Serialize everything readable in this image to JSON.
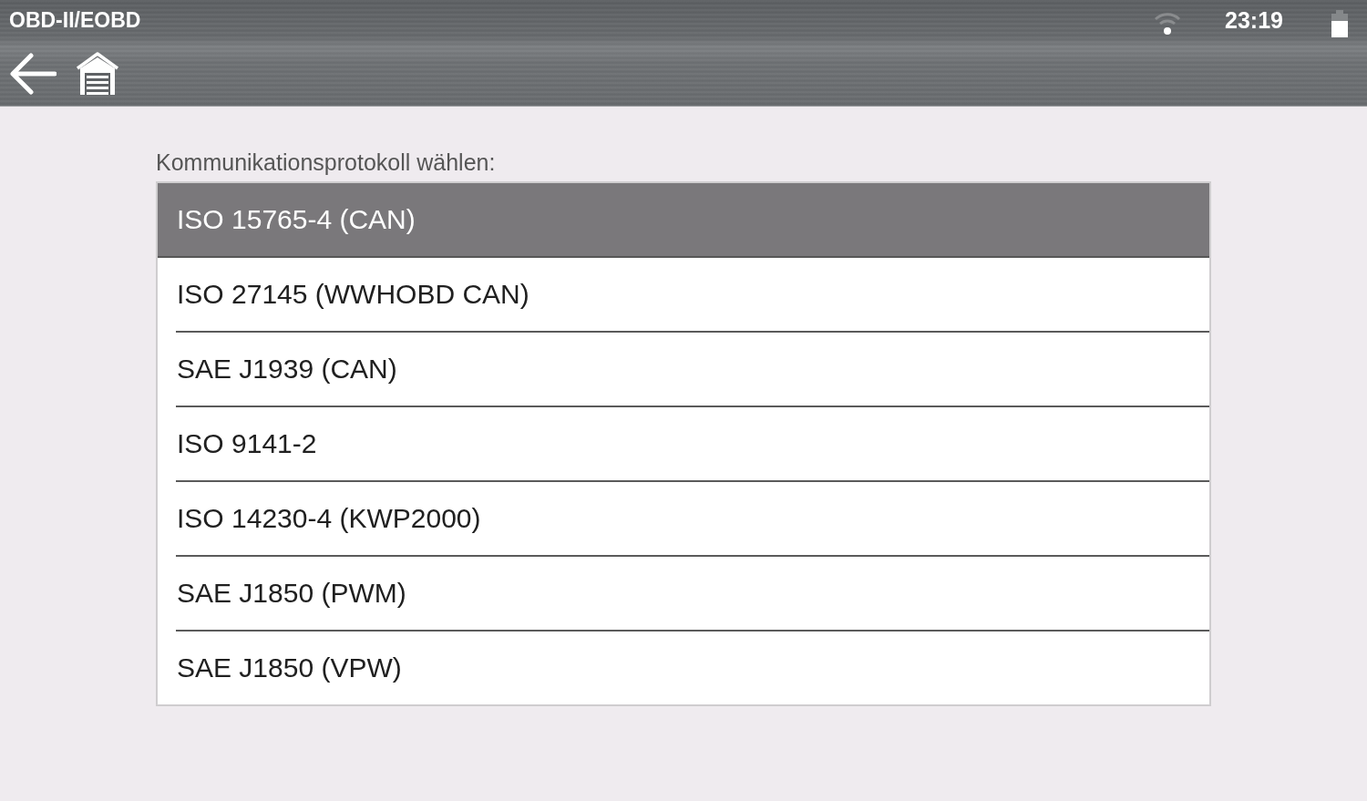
{
  "status_bar": {
    "title": "OBD-II/EOBD",
    "time": "23:19"
  },
  "prompt": "Kommunikationsprotokoll wählen:",
  "protocols": [
    {
      "label": "ISO 15765-4 (CAN)",
      "selected": true
    },
    {
      "label": "ISO 27145 (WWHOBD CAN)",
      "selected": false
    },
    {
      "label": "SAE J1939 (CAN)",
      "selected": false
    },
    {
      "label": "ISO 9141-2",
      "selected": false
    },
    {
      "label": "ISO 14230-4 (KWP2000)",
      "selected": false
    },
    {
      "label": "SAE J1850 (PWM)",
      "selected": false
    },
    {
      "label": "SAE J1850 (VPW)",
      "selected": false
    }
  ]
}
